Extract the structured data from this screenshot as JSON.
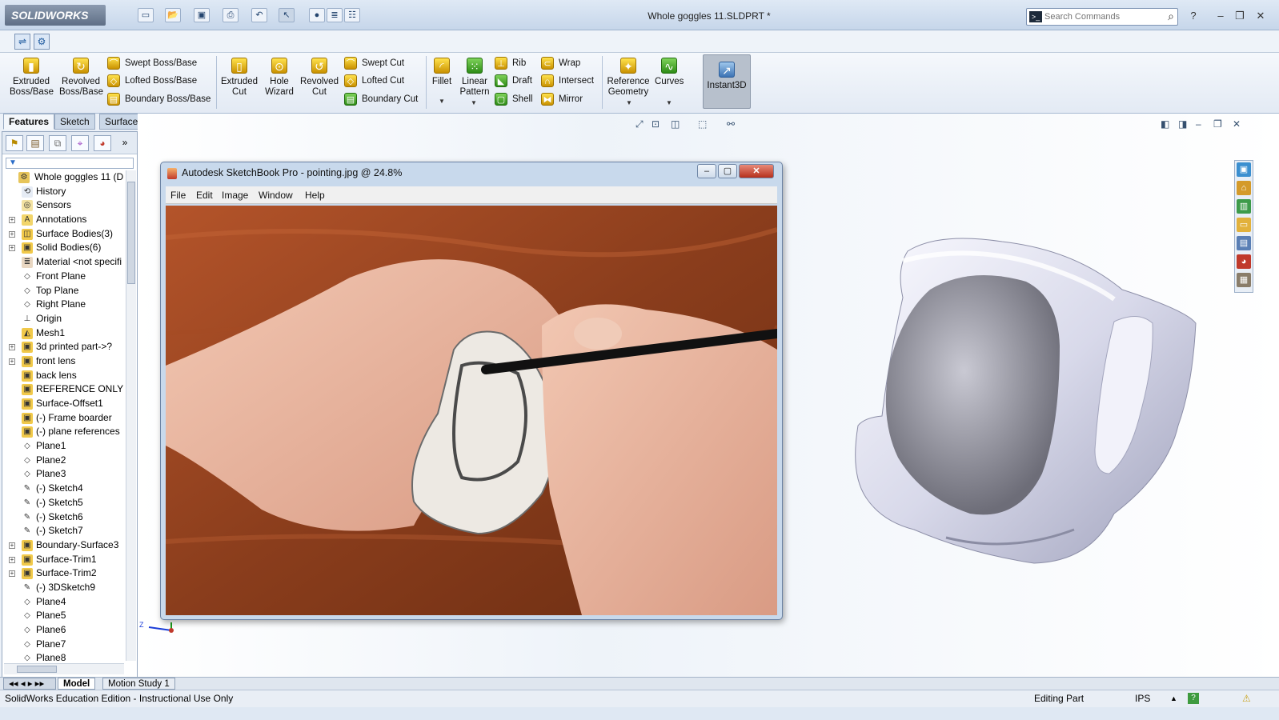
{
  "app": {
    "logo": "SOLIDWORKS",
    "document_title": "Whole goggles 11.SLDPRT *",
    "search": {
      "placeholder": "Search Commands"
    }
  },
  "ribbon": {
    "extruded_boss": "Extruded\nBoss/Base",
    "revolved_boss": "Revolved\nBoss/Base",
    "swept_boss": "Swept Boss/Base",
    "lofted_boss": "Lofted Boss/Base",
    "boundary_boss": "Boundary Boss/Base",
    "extruded_cut": "Extruded\nCut",
    "hole_wizard": "Hole\nWizard",
    "revolved_cut": "Revolved\nCut",
    "swept_cut": "Swept Cut",
    "lofted_cut": "Lofted Cut",
    "boundary_cut": "Boundary Cut",
    "fillet": "Fillet",
    "linear_pattern": "Linear\nPattern",
    "rib": "Rib",
    "draft": "Draft",
    "shell": "Shell",
    "wrap": "Wrap",
    "intersect": "Intersect",
    "mirror": "Mirror",
    "reference_geometry": "Reference\nGeometry",
    "curves": "Curves",
    "instant3d": "Instant3D"
  },
  "tabs": [
    "Features",
    "Sketch",
    "Surfaces"
  ],
  "tree": {
    "root": "Whole goggles 11  (D",
    "items": [
      "History",
      "Sensors",
      "Annotations",
      "Surface Bodies(3)",
      "Solid Bodies(6)",
      "Material <not specifi",
      "Front Plane",
      "Top Plane",
      "Right Plane",
      "Origin",
      "Mesh1",
      "3d printed part->?",
      "front lens",
      "back lens",
      "REFERENCE ONLY fra",
      "Surface-Offset1",
      "(-) Frame boarder",
      "(-) plane references",
      "Plane1",
      "Plane2",
      "Plane3",
      "(-) Sketch4",
      "(-) Sketch5",
      "(-) Sketch6",
      "(-) Sketch7",
      "Boundary-Surface3",
      "Surface-Trim1",
      "Surface-Trim2",
      "(-) 3DSketch9",
      "Plane4",
      "Plane5",
      "Plane6",
      "Plane7",
      "Plane8"
    ]
  },
  "sketchbook": {
    "title": "Autodesk SketchBook Pro - pointing.jpg @ 24.8%",
    "menu": [
      "File",
      "Edit",
      "Image",
      "Window",
      "Help"
    ]
  },
  "bottom_tabs": [
    "Model",
    "Motion Study 1"
  ],
  "status": {
    "left": "SolidWorks Education Edition - Instructional Use Only",
    "editing": "Editing Part",
    "units": "IPS"
  },
  "triad_label": "Z"
}
